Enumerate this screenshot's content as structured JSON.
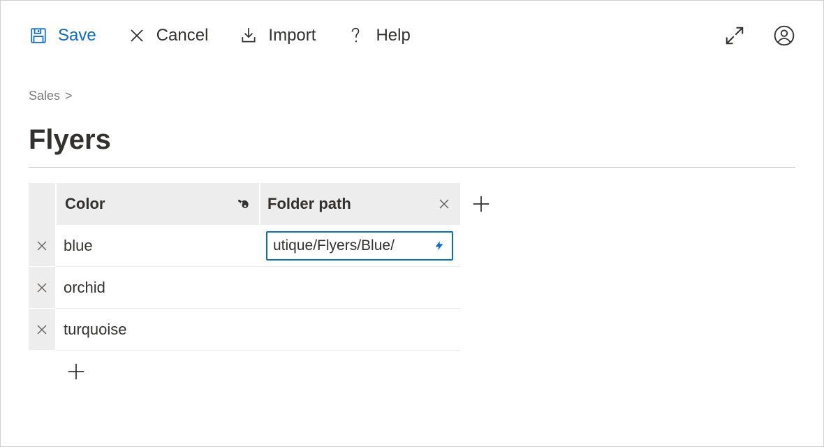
{
  "colors": {
    "accent": "#0b6bcb"
  },
  "toolbar": {
    "save_label": "Save",
    "cancel_label": "Cancel",
    "import_label": "Import",
    "help_label": "Help"
  },
  "breadcrumb": {
    "parent": "Sales",
    "separator": ">"
  },
  "page": {
    "title": "Flyers"
  },
  "table": {
    "columns": {
      "color": {
        "header": "Color",
        "is_key": true
      },
      "path": {
        "header": "Folder path"
      }
    },
    "rows": [
      {
        "color": "blue",
        "path": "utique/Flyers/Blue/",
        "path_active": true
      },
      {
        "color": "orchid",
        "path": ""
      },
      {
        "color": "turquoise",
        "path": ""
      }
    ]
  }
}
